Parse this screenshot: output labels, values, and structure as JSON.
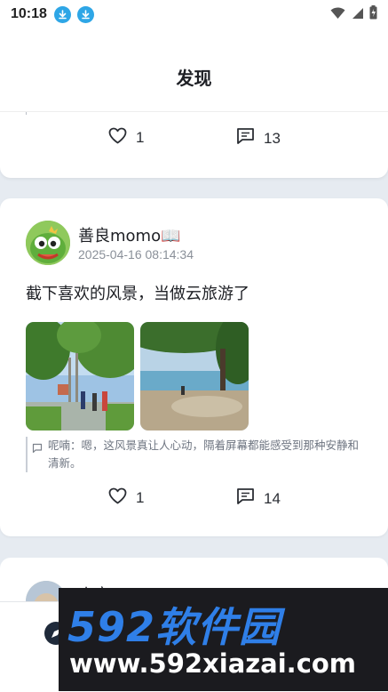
{
  "status_bar": {
    "time": "10:18"
  },
  "header": {
    "title": "发现"
  },
  "post1": {
    "likes": "1",
    "comments": "13"
  },
  "post2": {
    "username": "善良momo📖",
    "timestamp": "2025-04-16 08:14:34",
    "text": "截下喜欢的风景，当做云旅游了",
    "comment_preview": "呢喃：嗯，这风景真让人心动，隔着屏幕都能感受到那种安静和清新。",
    "likes": "1",
    "comments": "14"
  },
  "post3": {
    "username_partial": "小章"
  },
  "watermark": {
    "line1": "592软件园",
    "line2": "www.592xiazai.com"
  },
  "colors": {
    "accent": "#2ea6e6",
    "background": "#e6ebf1",
    "watermark_blue": "#2f7fe8"
  },
  "icons": [
    "download-icon",
    "wifi-icon",
    "signal-icon",
    "battery-icon",
    "heart-icon",
    "comment-icon",
    "comment-quote-icon",
    "nav-compass-icon"
  ]
}
